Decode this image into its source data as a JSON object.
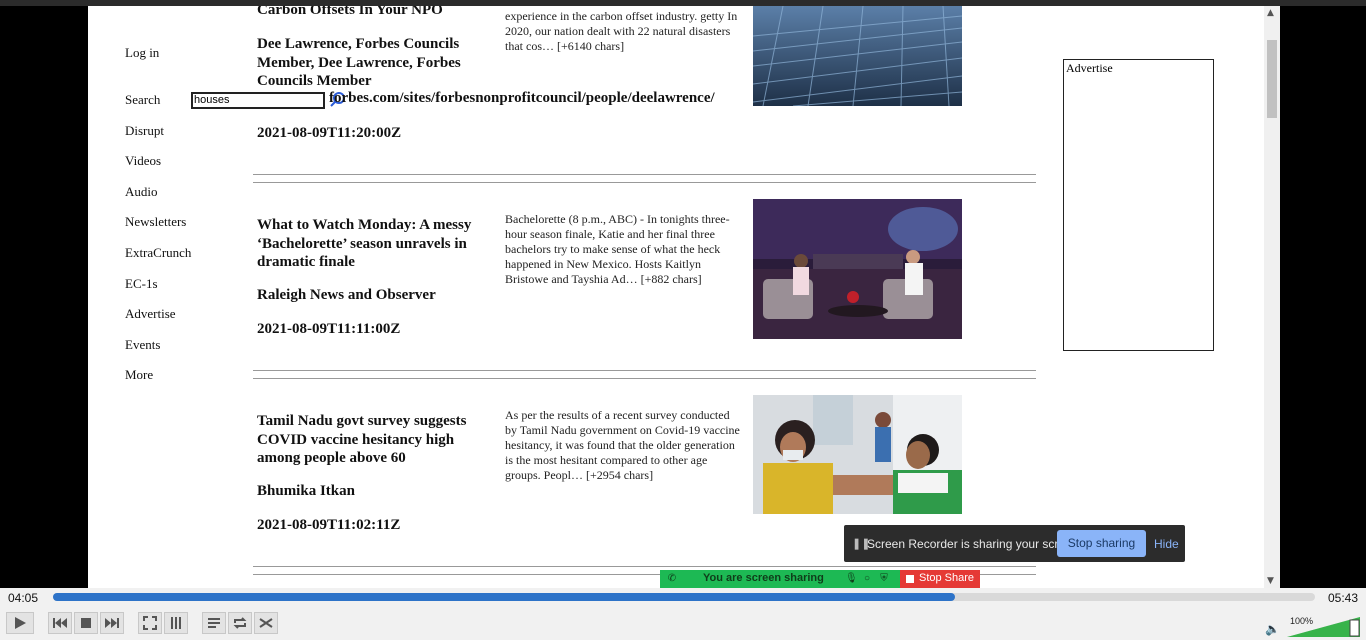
{
  "nav": {
    "login": "Log in",
    "search_label": "Search",
    "search_value": "houses",
    "items": [
      "Disrupt",
      "Videos",
      "Audio",
      "Newsletters",
      "ExtraCrunch",
      "EC-1s",
      "Advertise",
      "Events",
      "More"
    ]
  },
  "articles": [
    {
      "title_tail": "Carbon Offsets In Your NPO",
      "author": "Dee Lawrence, Forbes Councils Member, Dee Lawrence, Forbes Councils Member",
      "url": "forbes.com/sites/forbesnonprofitcouncil/people/deelawrence/",
      "date": "2021-08-09T11:20:00Z",
      "desc": "experience in the carbon offset industry. getty In 2020, our nation dealt with 22 natural disasters that cos… [+6140 chars]"
    },
    {
      "title": "What to Watch Monday: A messy ‘Bachelorette’ season unravels in dramatic finale",
      "author": "Raleigh News and Observer",
      "date": "2021-08-09T11:11:00Z",
      "desc": "Bachelorette (8 p.m., ABC) - In tonights three-hour season finale, Katie and her final three bachelors try to make sense of what the heck happened in New Mexico. Hosts Kaitlyn Bristowe and Tayshia Ad… [+882 chars]"
    },
    {
      "title": "Tamil Nadu govt survey suggests COVID vaccine hesitancy high among people above 60",
      "author": "Bhumika Itkan",
      "date": "2021-08-09T11:02:11Z",
      "desc": "As per the results of a recent survey conducted by Tamil Nadu government on Covid-19 vaccine hesitancy, it was found that the older generation is the most hesitant compared to other age groups. Peopl… [+2954 chars]"
    }
  ],
  "ad": {
    "label": "Advertise"
  },
  "recorder": {
    "message": "Screen Recorder is sharing your screen.",
    "stop_label": "Stop sharing",
    "hide_label": "Hide"
  },
  "share_bar": {
    "sharing_label": "You are screen sharing",
    "stop_label": "Stop Share",
    "colors": {
      "green": "#1db954",
      "red": "#e53935"
    }
  },
  "player": {
    "elapsed": "04:05",
    "total": "05:43",
    "progress": 0.715,
    "volume_label": "100%",
    "accent": "#2d73c8"
  }
}
